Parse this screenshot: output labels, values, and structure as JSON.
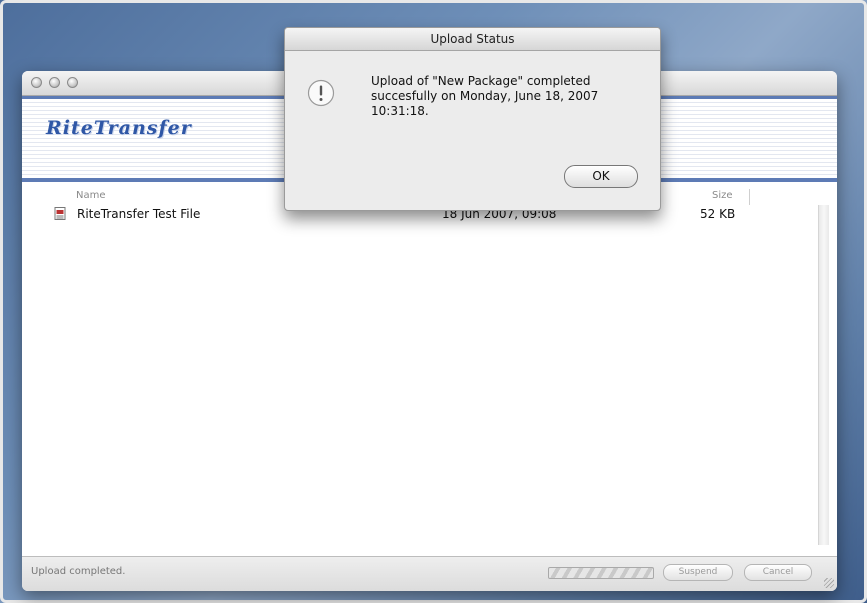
{
  "window": {
    "app_logo": "RiteTransfer"
  },
  "file_list": {
    "columns": {
      "name": "Name",
      "size": "Size"
    },
    "rows": [
      {
        "name": "RiteTransfer Test File",
        "date": "18 Jun 2007, 09:08",
        "size": "52 KB"
      }
    ]
  },
  "statusbar": {
    "text": "Upload completed.",
    "suspend_label": "Suspend",
    "cancel_label": "Cancel"
  },
  "dialog": {
    "title": "Upload Status",
    "message": "Upload of \"New Package\" completed succesfully on Monday, June 18, 2007 10:31:18.",
    "ok_label": "OK"
  },
  "colors": {
    "banner_stripe": "#5d7bb5",
    "logo": "#2f57a6"
  }
}
